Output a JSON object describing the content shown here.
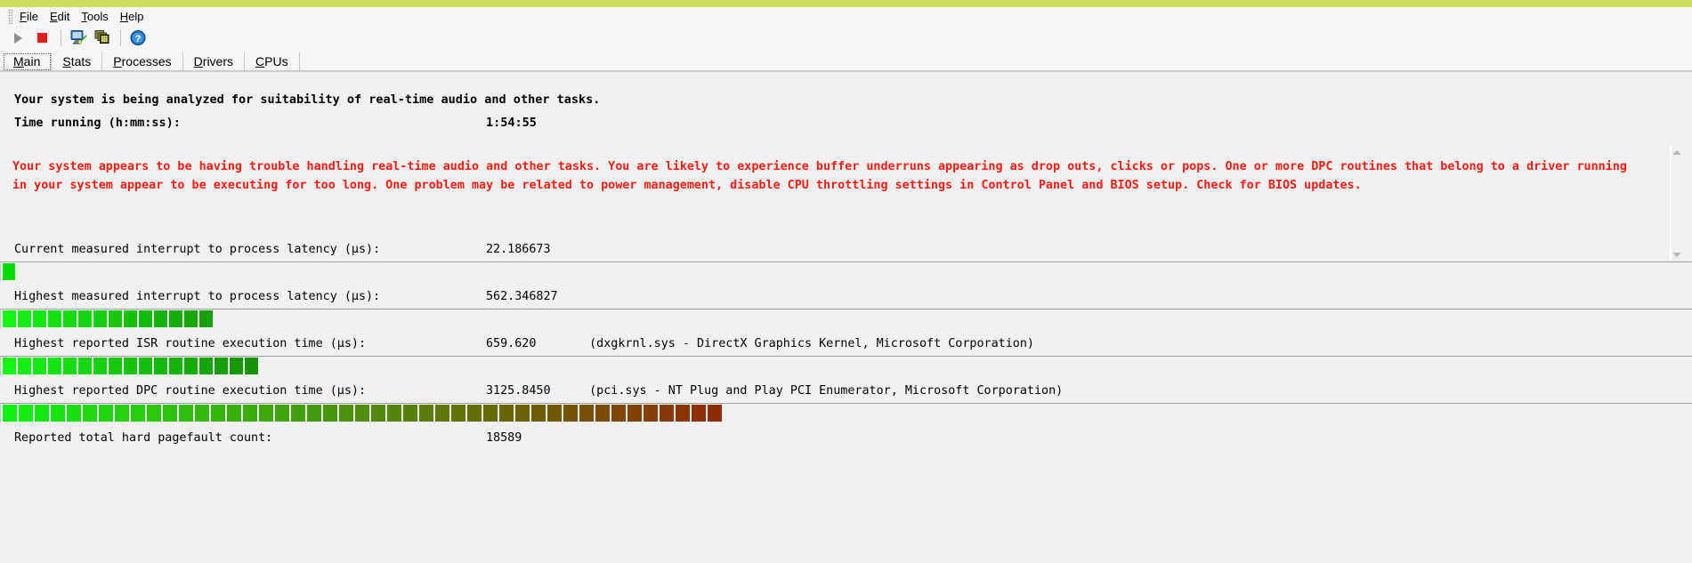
{
  "window": {
    "accent_color": "#cddc5c",
    "background": "#f0f0f0"
  },
  "menubar": {
    "items": [
      {
        "name": "file",
        "label": "File",
        "accel": "F"
      },
      {
        "name": "edit",
        "label": "Edit",
        "accel": "E"
      },
      {
        "name": "tools",
        "label": "Tools",
        "accel": "T"
      },
      {
        "name": "help",
        "label": "Help",
        "accel": "H"
      }
    ]
  },
  "toolbar": {
    "buttons": [
      {
        "name": "start-monitoring-button",
        "icon": "play-icon",
        "enabled": false
      },
      {
        "name": "stop-monitoring-button",
        "icon": "stop-icon",
        "enabled": true
      },
      {
        "name": "system-info-button",
        "icon": "monitor-wand-icon",
        "enabled": true
      },
      {
        "name": "report-button",
        "icon": "windows-stack-icon",
        "enabled": true
      },
      {
        "name": "help-button",
        "icon": "question-help-icon",
        "enabled": true
      }
    ]
  },
  "tabs": {
    "active": "Main",
    "items": [
      {
        "name": "tab-main",
        "label": "Main",
        "accel": "M"
      },
      {
        "name": "tab-stats",
        "label": "Stats",
        "accel": "S"
      },
      {
        "name": "tab-processes",
        "label": "Processes",
        "accel": "P"
      },
      {
        "name": "tab-drivers",
        "label": "Drivers",
        "accel": "D"
      },
      {
        "name": "tab-cpus",
        "label": "CPUs",
        "accel": "C"
      }
    ]
  },
  "summary": {
    "status_line": "Your system is being analyzed for suitability of real-time audio and other tasks.",
    "time_label": "Time running (h:mm:ss):",
    "time_value": "1:54:55"
  },
  "warning": {
    "color": "#fb1d11",
    "text": "Your system appears to be having trouble handling real-time audio and other tasks. You are likely to experience buffer underruns appearing as drop outs, clicks or pops. One or more DPC routines that belong to a driver running in your system appear to be executing for too long. One problem may be related to power management, disable CPU throttling settings in Control Panel and BIOS setup. Check for BIOS updates."
  },
  "metrics": [
    {
      "name": "current-interrupt-to-process-latency",
      "label": "Current measured interrupt to process latency (µs):",
      "value": "22.186673",
      "extra": "",
      "bar": {
        "segments": 1,
        "seg_width": 14,
        "start_color": "#00dd00",
        "end_color": "#00dd00"
      }
    },
    {
      "name": "highest-interrupt-to-process-latency",
      "label": "Highest measured interrupt to process latency (µs):",
      "value": "562.346827",
      "extra": "",
      "bar": {
        "segments": 14,
        "seg_width": 15,
        "start_color": "#14f514",
        "end_color": "#17a007"
      }
    },
    {
      "name": "highest-isr-routine-execution-time",
      "label": "Highest reported ISR routine execution time (µs):",
      "value": "659.620",
      "extra": "(dxgkrnl.sys - DirectX Graphics Kernel, Microsoft Corporation)",
      "bar": {
        "segments": 17,
        "seg_width": 15,
        "start_color": "#14f514",
        "end_color": "#169307"
      }
    },
    {
      "name": "highest-dpc-routine-execution-time",
      "label": "Highest reported DPC routine execution time (µs):",
      "value": "3125.8450",
      "extra": "(pci.sys - NT Plug and Play PCI Enumerator, Microsoft Corporation)",
      "bar": {
        "segments": 45,
        "seg_width": 16,
        "start_color": "#0ff00f",
        "end_color": "#8f2b04"
      }
    },
    {
      "name": "reported-total-hard-pagefault-count",
      "label": "Reported total hard pagefault count:",
      "value": "18589",
      "extra": "",
      "bar": null
    }
  ]
}
